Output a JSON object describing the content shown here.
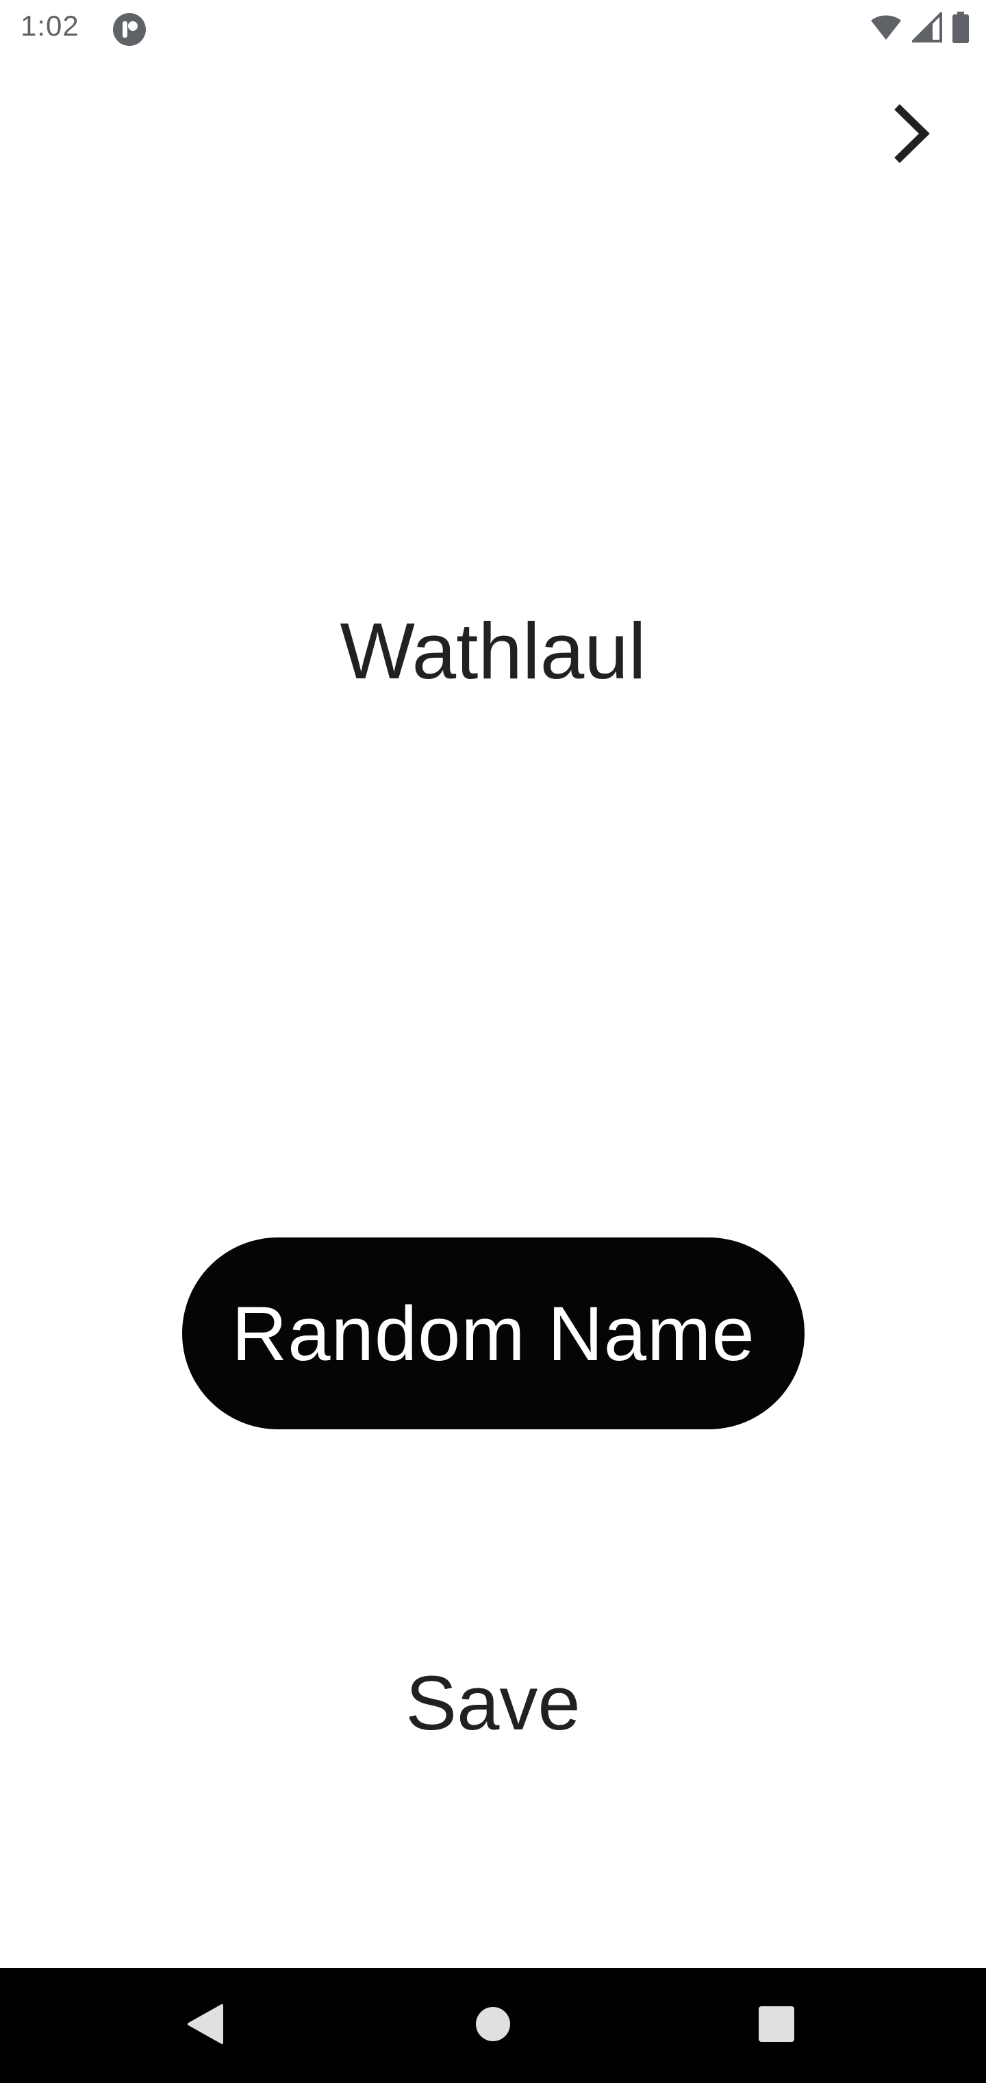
{
  "status_bar": {
    "time": "1:02",
    "icons": [
      "app-notification-icon",
      "wifi-icon",
      "cellular-signal-icon",
      "battery-icon"
    ]
  },
  "toolbar": {
    "next_icon": "chevron-right-icon"
  },
  "main": {
    "generated_name": "Wathlaul",
    "random_button_label": "Random Name",
    "save_label": "Save"
  },
  "nav_bar": {
    "icons": [
      "back-icon",
      "home-icon",
      "recents-icon"
    ]
  },
  "colors": {
    "background": "#ffffff",
    "button_background": "#050505",
    "button_text": "#ffffff",
    "text": "#212121",
    "nav_background": "#000000",
    "nav_icon": "#e0e0e0",
    "status_icon": "#5f6368"
  }
}
